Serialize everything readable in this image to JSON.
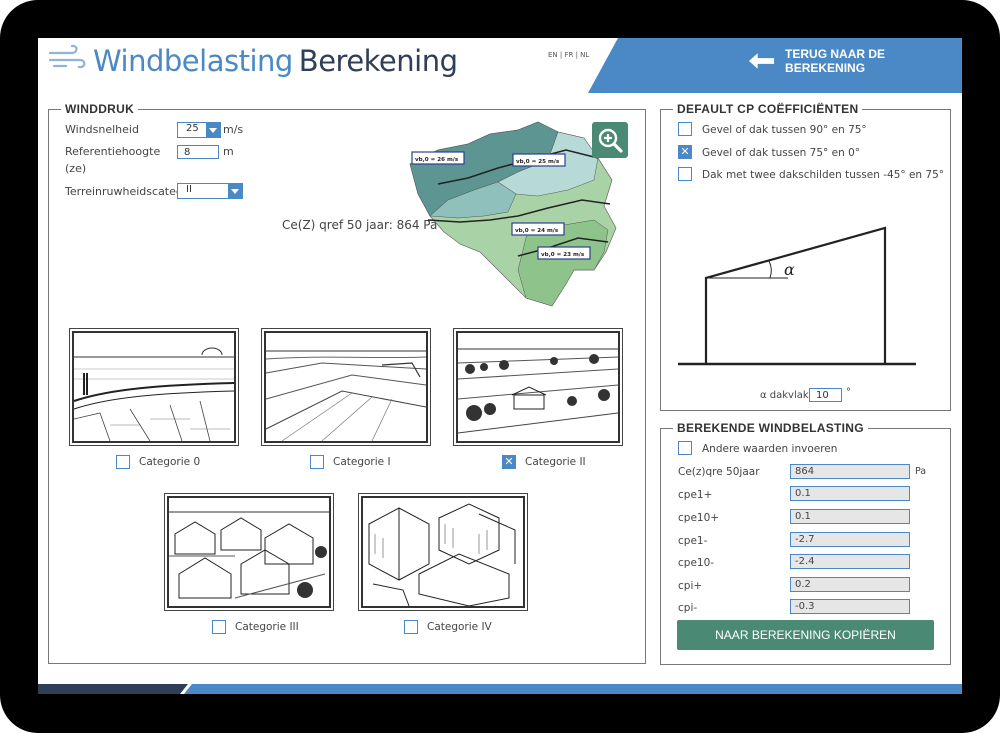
{
  "app": {
    "title_part1": "Windbelasting",
    "title_part2": "Berekening",
    "lang": "EN | FR | NL",
    "back_label": "TERUG NAAR DE BEREKENING"
  },
  "winddruk": {
    "legend": "WINDDRUK",
    "windsnelheid_label": "Windsnelheid",
    "windsnelheid_value": "25",
    "windsnelheid_unit": "m/s",
    "ref_label_1": "Referentiehoogte",
    "ref_label_2": "(ze)",
    "ref_value": "8",
    "ref_unit": "m",
    "terrein_label": "Terreinruwheidscategorie",
    "terrein_value": "II",
    "result": "Ce(Z) qref 50 jaar: 864 Pa",
    "map_labels": [
      "vb,0 = 26 m/s",
      "vb,0 = 25 m/s",
      "vb,0 = 24 m/s",
      "vb,0 = 23 m/s"
    ],
    "categories": [
      {
        "label": "Categorie 0",
        "checked": false
      },
      {
        "label": "Categorie I",
        "checked": false
      },
      {
        "label": "Categorie II",
        "checked": true
      },
      {
        "label": "Categorie III",
        "checked": false
      },
      {
        "label": "Categorie IV",
        "checked": false
      }
    ]
  },
  "cp": {
    "legend": "DEFAULT CP COËFFICIËNTEN",
    "options": [
      {
        "label": "Gevel of dak tussen 90° en 75°",
        "checked": false
      },
      {
        "label": "Gevel of dak tussen 75° en 0°",
        "checked": true
      },
      {
        "label": "Dak met twee dakschilden tussen -45° en 75°",
        "checked": false
      }
    ],
    "alpha_symbol": "α",
    "dakvlak_label": "α dakvlak:",
    "dakvlak_value": "10",
    "dakvlak_unit": "°"
  },
  "berekende": {
    "legend": "BEREKENDE WINDBELASTING",
    "other_values_label": "Andere waarden invoeren",
    "rows": [
      {
        "label": "Ce(z)qre 50jaar",
        "value": "864",
        "unit": "Pa"
      },
      {
        "label": "cpe1+",
        "value": "0.1",
        "unit": ""
      },
      {
        "label": "cpe10+",
        "value": "0.1",
        "unit": ""
      },
      {
        "label": "cpe1-",
        "value": "-2.7",
        "unit": ""
      },
      {
        "label": "cpe10-",
        "value": "-2.4",
        "unit": ""
      },
      {
        "label": "cpi+",
        "value": "0.2",
        "unit": ""
      },
      {
        "label": "cpi-",
        "value": "-0.3",
        "unit": ""
      }
    ],
    "copy_button": "NAAR BEREKENING KOPIËREN"
  },
  "colors": {
    "accent": "#4b88c6",
    "navy": "#2f3f58",
    "button": "#4a8a75",
    "map_dark": "#4f8a87",
    "map_light": "#a9d3a6"
  }
}
